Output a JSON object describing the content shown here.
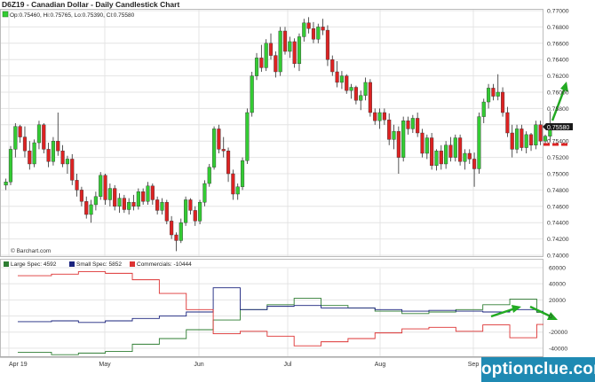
{
  "chart_data": [
    {
      "type": "candlestick",
      "title": "D6Z19 - Canadian Dollar - Daily Candlestick Chart",
      "legend": "Op:0.75460, Hi:0.75765, Lo:0.75390, Cl:0.75580",
      "credit": "© Barchart.com",
      "last_price_label": "0.75580",
      "ylim": [
        0.74,
        0.77
      ],
      "y_ticks": [
        "0.77000",
        "0.76800",
        "0.76600",
        "0.76400",
        "0.76200",
        "0.76000",
        "0.75800",
        "0.75600",
        "0.75400",
        "0.75200",
        "0.75000",
        "0.74800",
        "0.74600",
        "0.74400",
        "0.74200",
        "0.74000"
      ],
      "x_labels": [
        "Apr 19",
        "May",
        "Jun",
        "Jul",
        "Aug",
        "Sep"
      ],
      "colors": {
        "up": "#33cc33",
        "down": "#dd2222",
        "wick": "#2b2b2b",
        "annotation": "#22aa22",
        "support": "#dd2222"
      },
      "candles": [
        [
          0.7486,
          0.7494,
          0.748,
          0.749
        ],
        [
          0.749,
          0.7534,
          0.7486,
          0.753
        ],
        [
          0.753,
          0.7562,
          0.752,
          0.7558
        ],
        [
          0.7558,
          0.756,
          0.7538,
          0.7545
        ],
        [
          0.7545,
          0.7558,
          0.752,
          0.7528
        ],
        [
          0.7528,
          0.754,
          0.7505,
          0.7512
        ],
        [
          0.7512,
          0.7542,
          0.7508,
          0.7538
        ],
        [
          0.7538,
          0.7565,
          0.753,
          0.756
        ],
        [
          0.756,
          0.7562,
          0.7525,
          0.753
        ],
        [
          0.753,
          0.7538,
          0.7508,
          0.7515
        ],
        [
          0.7515,
          0.7545,
          0.751,
          0.754
        ],
        [
          0.754,
          0.7575,
          0.7522,
          0.7528
        ],
        [
          0.7528,
          0.7535,
          0.7508,
          0.7512
        ],
        [
          0.7512,
          0.7522,
          0.75,
          0.7518
        ],
        [
          0.7518,
          0.7524,
          0.7486,
          0.7492
        ],
        [
          0.7492,
          0.75,
          0.7472,
          0.748
        ],
        [
          0.748,
          0.7484,
          0.746,
          0.7466
        ],
        [
          0.7466,
          0.7472,
          0.7445,
          0.745
        ],
        [
          0.745,
          0.7468,
          0.744,
          0.7462
        ],
        [
          0.7462,
          0.7478,
          0.7455,
          0.7472
        ],
        [
          0.7472,
          0.7502,
          0.7468,
          0.7498
        ],
        [
          0.7498,
          0.75,
          0.7462,
          0.7468
        ],
        [
          0.7468,
          0.7488,
          0.746,
          0.7482
        ],
        [
          0.7482,
          0.7486,
          0.7455,
          0.746
        ],
        [
          0.746,
          0.7476,
          0.7452,
          0.747
        ],
        [
          0.747,
          0.7474,
          0.7452,
          0.7456
        ],
        [
          0.7456,
          0.747,
          0.745,
          0.7465
        ],
        [
          0.7465,
          0.7474,
          0.7455,
          0.746
        ],
        [
          0.746,
          0.7482,
          0.7456,
          0.7478
        ],
        [
          0.7478,
          0.7482,
          0.7462,
          0.7466
        ],
        [
          0.7466,
          0.749,
          0.7462,
          0.7485
        ],
        [
          0.7485,
          0.7488,
          0.7462,
          0.7468
        ],
        [
          0.7468,
          0.7472,
          0.745,
          0.7455
        ],
        [
          0.7455,
          0.747,
          0.745,
          0.7465
        ],
        [
          0.7465,
          0.7468,
          0.7438,
          0.7442
        ],
        [
          0.7442,
          0.7448,
          0.742,
          0.7425
        ],
        [
          0.7425,
          0.7428,
          0.7405,
          0.7418
        ],
        [
          0.7418,
          0.7445,
          0.7415,
          0.744
        ],
        [
          0.744,
          0.7472,
          0.7436,
          0.7468
        ],
        [
          0.7468,
          0.747,
          0.745,
          0.7455
        ],
        [
          0.7455,
          0.746,
          0.7436,
          0.7442
        ],
        [
          0.7442,
          0.7468,
          0.7438,
          0.7465
        ],
        [
          0.7465,
          0.7492,
          0.746,
          0.7488
        ],
        [
          0.7488,
          0.7512,
          0.7484,
          0.7508
        ],
        [
          0.7508,
          0.7558,
          0.7505,
          0.7555
        ],
        [
          0.7555,
          0.756,
          0.7525,
          0.753
        ],
        [
          0.753,
          0.7545,
          0.752,
          0.7528
        ],
        [
          0.7528,
          0.7532,
          0.749,
          0.75
        ],
        [
          0.75,
          0.7505,
          0.7468,
          0.7475
        ],
        [
          0.7475,
          0.7488,
          0.7468,
          0.7484
        ],
        [
          0.7484,
          0.752,
          0.748,
          0.7516
        ],
        [
          0.7516,
          0.758,
          0.7512,
          0.7575
        ],
        [
          0.7575,
          0.7625,
          0.757,
          0.762
        ],
        [
          0.762,
          0.7648,
          0.7615,
          0.7642
        ],
        [
          0.7642,
          0.7658,
          0.7625,
          0.763
        ],
        [
          0.763,
          0.7665,
          0.7626,
          0.766
        ],
        [
          0.766,
          0.7672,
          0.764,
          0.7645
        ],
        [
          0.7645,
          0.765,
          0.7618,
          0.7625
        ],
        [
          0.7625,
          0.768,
          0.762,
          0.7675
        ],
        [
          0.7675,
          0.768,
          0.7646,
          0.765
        ],
        [
          0.765,
          0.7668,
          0.7642,
          0.7662
        ],
        [
          0.7662,
          0.7666,
          0.763,
          0.7635
        ],
        [
          0.7635,
          0.7672,
          0.7626,
          0.7668
        ],
        [
          0.7668,
          0.769,
          0.7662,
          0.7685
        ],
        [
          0.7685,
          0.7692,
          0.7672,
          0.7678
        ],
        [
          0.7678,
          0.7686,
          0.766,
          0.7665
        ],
        [
          0.7665,
          0.7684,
          0.766,
          0.768
        ],
        [
          0.768,
          0.769,
          0.767,
          0.7676
        ],
        [
          0.7676,
          0.7682,
          0.7632,
          0.764
        ],
        [
          0.764,
          0.7645,
          0.762,
          0.7625
        ],
        [
          0.7625,
          0.7638,
          0.7606,
          0.7612
        ],
        [
          0.7612,
          0.7626,
          0.7604,
          0.762
        ],
        [
          0.762,
          0.7622,
          0.7598,
          0.7602
        ],
        [
          0.7602,
          0.761,
          0.7592,
          0.7606
        ],
        [
          0.7606,
          0.7608,
          0.7585,
          0.759
        ],
        [
          0.759,
          0.7602,
          0.7578,
          0.7596
        ],
        [
          0.7596,
          0.7618,
          0.759,
          0.7612
        ],
        [
          0.7612,
          0.7616,
          0.757,
          0.7575
        ],
        [
          0.7575,
          0.758,
          0.756,
          0.7565
        ],
        [
          0.7565,
          0.758,
          0.7555,
          0.7575
        ],
        [
          0.7575,
          0.758,
          0.756,
          0.7566
        ],
        [
          0.7566,
          0.7574,
          0.7535,
          0.7542
        ],
        [
          0.7542,
          0.756,
          0.753,
          0.7552
        ],
        [
          0.7552,
          0.7558,
          0.75,
          0.752
        ],
        [
          0.752,
          0.757,
          0.7515,
          0.7565
        ],
        [
          0.7565,
          0.757,
          0.7548,
          0.7555
        ],
        [
          0.7555,
          0.7572,
          0.755,
          0.7568
        ],
        [
          0.7568,
          0.7575,
          0.7545,
          0.755
        ],
        [
          0.755,
          0.7555,
          0.752,
          0.7525
        ],
        [
          0.7525,
          0.7548,
          0.7518,
          0.7544
        ],
        [
          0.7544,
          0.755,
          0.7505,
          0.751
        ],
        [
          0.751,
          0.753,
          0.7504,
          0.7528
        ],
        [
          0.7528,
          0.7535,
          0.7505,
          0.7512
        ],
        [
          0.7512,
          0.754,
          0.7506,
          0.7535
        ],
        [
          0.7535,
          0.7545,
          0.7515,
          0.752
        ],
        [
          0.752,
          0.7548,
          0.7515,
          0.7544
        ],
        [
          0.7544,
          0.7548,
          0.751,
          0.7515
        ],
        [
          0.7515,
          0.753,
          0.7505,
          0.7525
        ],
        [
          0.7525,
          0.753,
          0.7512,
          0.7518
        ],
        [
          0.7518,
          0.7526,
          0.7484,
          0.7506
        ],
        [
          0.7506,
          0.7575,
          0.75,
          0.757
        ],
        [
          0.757,
          0.7592,
          0.7562,
          0.7588
        ],
        [
          0.7588,
          0.761,
          0.758,
          0.7605
        ],
        [
          0.7605,
          0.761,
          0.759,
          0.7595
        ],
        [
          0.7595,
          0.7622,
          0.759,
          0.76
        ],
        [
          0.76,
          0.7606,
          0.757,
          0.7575
        ],
        [
          0.7575,
          0.7582,
          0.7545,
          0.755
        ],
        [
          0.755,
          0.756,
          0.752,
          0.753
        ],
        [
          0.753,
          0.756,
          0.7525,
          0.7555
        ],
        [
          0.7555,
          0.756,
          0.7528,
          0.7532
        ],
        [
          0.7532,
          0.7552,
          0.7525,
          0.7548
        ],
        [
          0.7548,
          0.755,
          0.7528,
          0.7535
        ],
        [
          0.7535,
          0.7565,
          0.753,
          0.756
        ],
        [
          0.756,
          0.7565,
          0.7535,
          0.754
        ],
        [
          0.754,
          0.7548,
          0.7536,
          0.7546
        ],
        [
          0.7546,
          0.75765,
          0.7539,
          0.7558
        ]
      ]
    },
    {
      "type": "line",
      "title": "",
      "ylim": [
        -50000,
        60000
      ],
      "y_ticks": [
        "60000",
        "40000",
        "20000",
        "0",
        "-20000",
        "-40000"
      ],
      "series": [
        {
          "name": "Large Spec: 4592",
          "color": "#2e7d32",
          "values": [
            -45000,
            -45000,
            -45000,
            -45000,
            -45000,
            -48000,
            -48000,
            -48000,
            -48000,
            -46000,
            -46000,
            -46000,
            -46000,
            -44000,
            -44000,
            -44000,
            -44000,
            -35000,
            -35000,
            -35000,
            -35000,
            -28000,
            -28000,
            -28000,
            -28000,
            -17000,
            -17000,
            -17000,
            -17000,
            -5000,
            -5000,
            -5000,
            -5000,
            8000,
            8000,
            8000,
            8000,
            14000,
            14000,
            14000,
            14000,
            22000,
            22000,
            22000,
            22000,
            13000,
            13000,
            13000,
            13000,
            10000,
            10000,
            10000,
            10000,
            6000,
            6000,
            6000,
            6000,
            3000,
            3000,
            3000,
            3000,
            5000,
            5000,
            5000,
            5000,
            8000,
            8000,
            8000,
            8000,
            14000,
            14000,
            14000,
            14000,
            21000,
            21000,
            21000,
            21000,
            4592,
            4592
          ]
        },
        {
          "name": "Small Spec: 5852",
          "color": "#1a237e",
          "values": [
            -7000,
            -7000,
            -7000,
            -7000,
            -7000,
            -6000,
            -6000,
            -6000,
            -6000,
            -8000,
            -8000,
            -8000,
            -8000,
            -6000,
            -6000,
            -6000,
            -6000,
            -3000,
            -3000,
            -3000,
            -3000,
            0,
            0,
            0,
            0,
            5000,
            5000,
            5000,
            5000,
            35000,
            35000,
            35000,
            35000,
            8000,
            8000,
            8000,
            8000,
            12000,
            12000,
            12000,
            12000,
            13000,
            13000,
            13000,
            13000,
            10000,
            10000,
            10000,
            10000,
            10000,
            10000,
            10000,
            10000,
            8000,
            8000,
            8000,
            8000,
            6000,
            6000,
            6000,
            6000,
            7000,
            7000,
            7000,
            7000,
            6000,
            6000,
            6000,
            6000,
            5000,
            5000,
            5000,
            5000,
            8000,
            8000,
            8000,
            8000,
            5852,
            5852
          ]
        },
        {
          "name": "Commercials: -10444",
          "color": "#dd3333",
          "values": [
            50000,
            50000,
            50000,
            50000,
            50000,
            52000,
            52000,
            52000,
            52000,
            55000,
            55000,
            55000,
            55000,
            53000,
            53000,
            53000,
            53000,
            45000,
            45000,
            45000,
            45000,
            28000,
            28000,
            28000,
            28000,
            8000,
            8000,
            8000,
            8000,
            -22000,
            -22000,
            -22000,
            -22000,
            -19000,
            -19000,
            -19000,
            -19000,
            -25000,
            -25000,
            -25000,
            -25000,
            -37000,
            -37000,
            -37000,
            -37000,
            -32000,
            -32000,
            -32000,
            -32000,
            -28000,
            -28000,
            -28000,
            -28000,
            -21000,
            -21000,
            -21000,
            -21000,
            -16000,
            -16000,
            -16000,
            -16000,
            -14000,
            -14000,
            -14000,
            -14000,
            -19000,
            -19000,
            -19000,
            -19000,
            -11000,
            -11000,
            -11000,
            -11000,
            -27000,
            -27000,
            -27000,
            -27000,
            -10444,
            -10444
          ]
        }
      ]
    }
  ],
  "watermark": "optionclue.com"
}
